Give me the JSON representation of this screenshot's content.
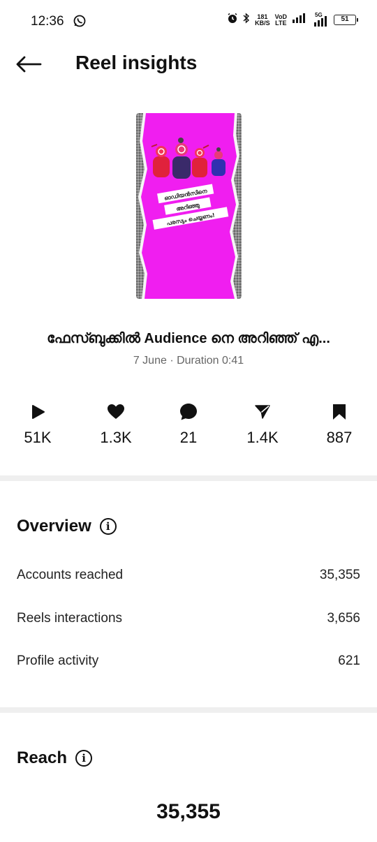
{
  "status_bar": {
    "time": "12:36",
    "speed_value": "181",
    "speed_unit": "KB/S",
    "volte_top": "VoD",
    "volte_bottom": "LTE",
    "network_type": "5G",
    "battery_level": "51"
  },
  "header": {
    "title": "Reel insights"
  },
  "reel": {
    "thumbnail_text": "ഓഡിയൻസിനെ അറിഞ്ഞു പരസ്യം ചെയ്യണം!",
    "thumbnail_bg": "#f01ef0",
    "title": "ഫേസ്ബുക്കിൽ Audience നെ അറിഞ്ഞ് എ...",
    "meta": "7 June · Duration 0:41"
  },
  "stats": [
    {
      "icon": "play-icon",
      "value": "51K"
    },
    {
      "icon": "heart-icon",
      "value": "1.3K"
    },
    {
      "icon": "comment-icon",
      "value": "21"
    },
    {
      "icon": "send-icon",
      "value": "1.4K"
    },
    {
      "icon": "bookmark-icon",
      "value": "887"
    }
  ],
  "overview": {
    "title": "Overview",
    "rows": [
      {
        "label": "Accounts reached",
        "value": "35,355"
      },
      {
        "label": "Reels interactions",
        "value": "3,656"
      },
      {
        "label": "Profile activity",
        "value": "621"
      }
    ]
  },
  "reach": {
    "title": "Reach",
    "value": "35,355"
  }
}
